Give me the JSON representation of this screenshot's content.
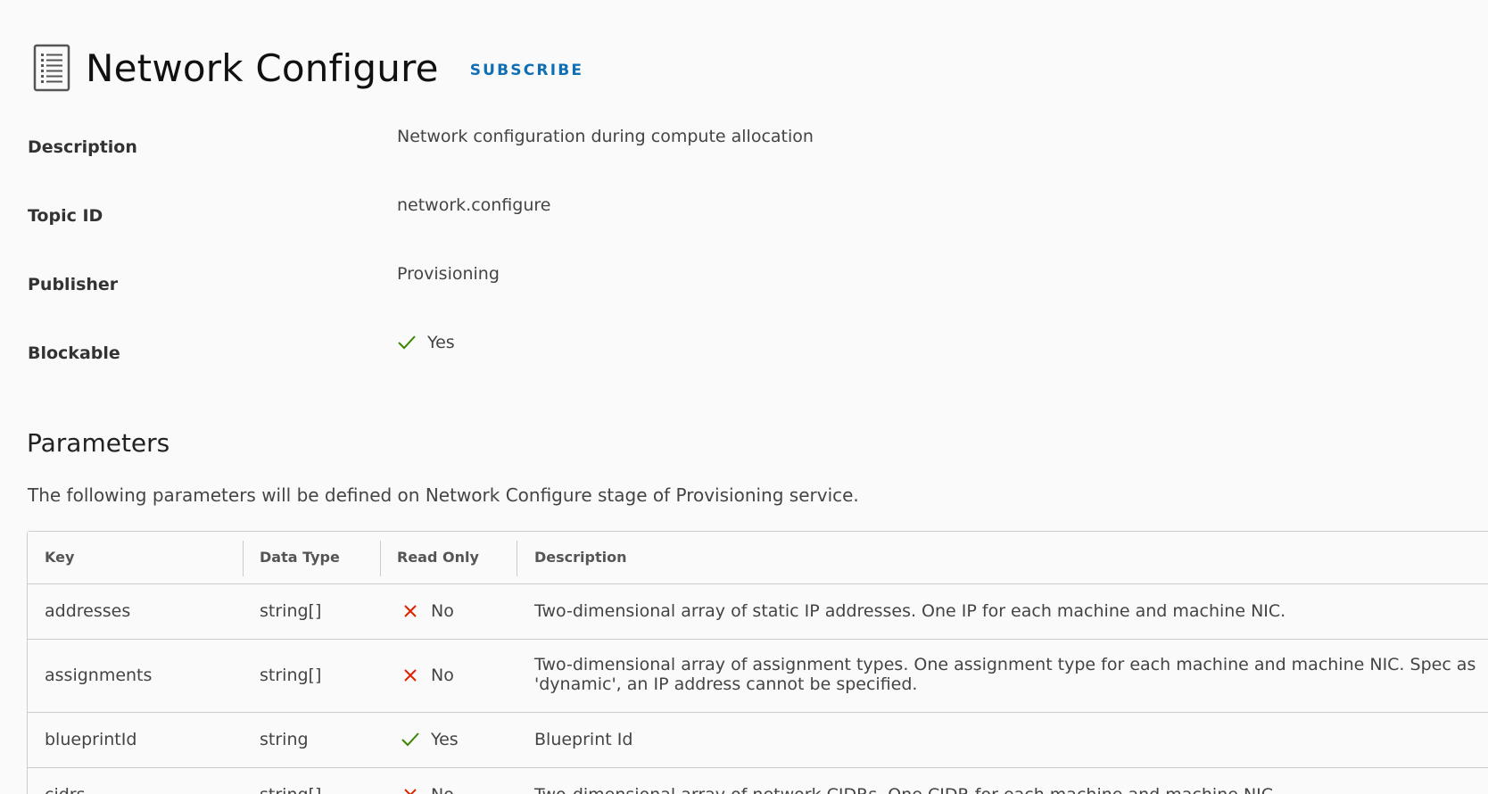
{
  "header": {
    "title": "Network Configure",
    "subscribe_label": "SUBSCRIBE",
    "icon": "document-icon"
  },
  "properties": [
    {
      "label": "Description",
      "value": "Network configuration during compute allocation"
    },
    {
      "label": "Topic ID",
      "value": "network.configure"
    },
    {
      "label": "Publisher",
      "value": "Provisioning"
    },
    {
      "label": "Blockable",
      "value": "Yes",
      "icon": "check-icon"
    }
  ],
  "parameters": {
    "title": "Parameters",
    "description": "The following parameters will be defined on Network Configure stage of Provisioning service.",
    "columns": [
      "Key",
      "Data Type",
      "Read Only",
      "Description"
    ],
    "rows": [
      {
        "key": "addresses",
        "type": "string[]",
        "read_only": "No",
        "read_only_icon": "x-icon",
        "description": "Two-dimensional array of static IP addresses. One IP for each machine and machine NIC."
      },
      {
        "key": "assignments",
        "type": "string[]",
        "read_only": "No",
        "read_only_icon": "x-icon",
        "description": "Two-dimensional array of assignment types. One assignment type for each machine and machine NIC. Spec as 'dynamic', an IP address cannot be specified."
      },
      {
        "key": "blueprintId",
        "type": "string",
        "read_only": "Yes",
        "read_only_icon": "check-icon",
        "description": "Blueprint Id"
      },
      {
        "key": "cidrs",
        "type": "string[]",
        "read_only": "No",
        "read_only_icon": "x-icon",
        "description": "Two-dimensional array of network CIDRs. One CIDR for each machine and machine NIC."
      }
    ]
  },
  "colors": {
    "accent": "#0f6eb4",
    "check": "#3c8500",
    "cross": "#e12200",
    "border": "#cccccc"
  }
}
